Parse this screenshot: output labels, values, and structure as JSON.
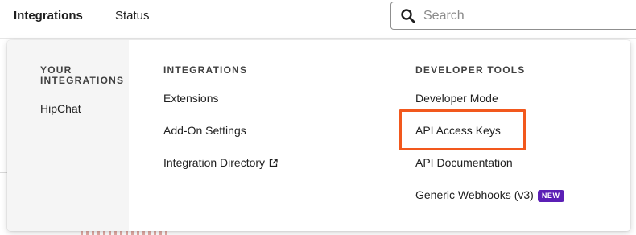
{
  "topnav": {
    "items": [
      {
        "label": "Integrations",
        "active": true
      },
      {
        "label": "Status",
        "active": false
      }
    ]
  },
  "search": {
    "placeholder": "Search",
    "icon": "search-icon"
  },
  "menu": {
    "your_integrations": {
      "heading": "YOUR INTEGRATIONS",
      "items": [
        "HipChat"
      ]
    },
    "integrations": {
      "heading": "INTEGRATIONS",
      "items": [
        {
          "label": "Extensions"
        },
        {
          "label": "Add-On Settings"
        },
        {
          "label": "Integration Directory",
          "icon": "external-link-icon"
        }
      ]
    },
    "developer_tools": {
      "heading": "DEVELOPER TOOLS",
      "items": [
        {
          "label": "Developer Mode"
        },
        {
          "label": "API Access Keys",
          "highlighted": true
        },
        {
          "label": "API Documentation"
        },
        {
          "label": "Generic Webhooks (v3)",
          "badge": "NEW"
        }
      ]
    }
  },
  "colors": {
    "highlight": "#f2581d",
    "badge": "#5b1fb5",
    "menu_left_bg": "#f5f5f5"
  }
}
